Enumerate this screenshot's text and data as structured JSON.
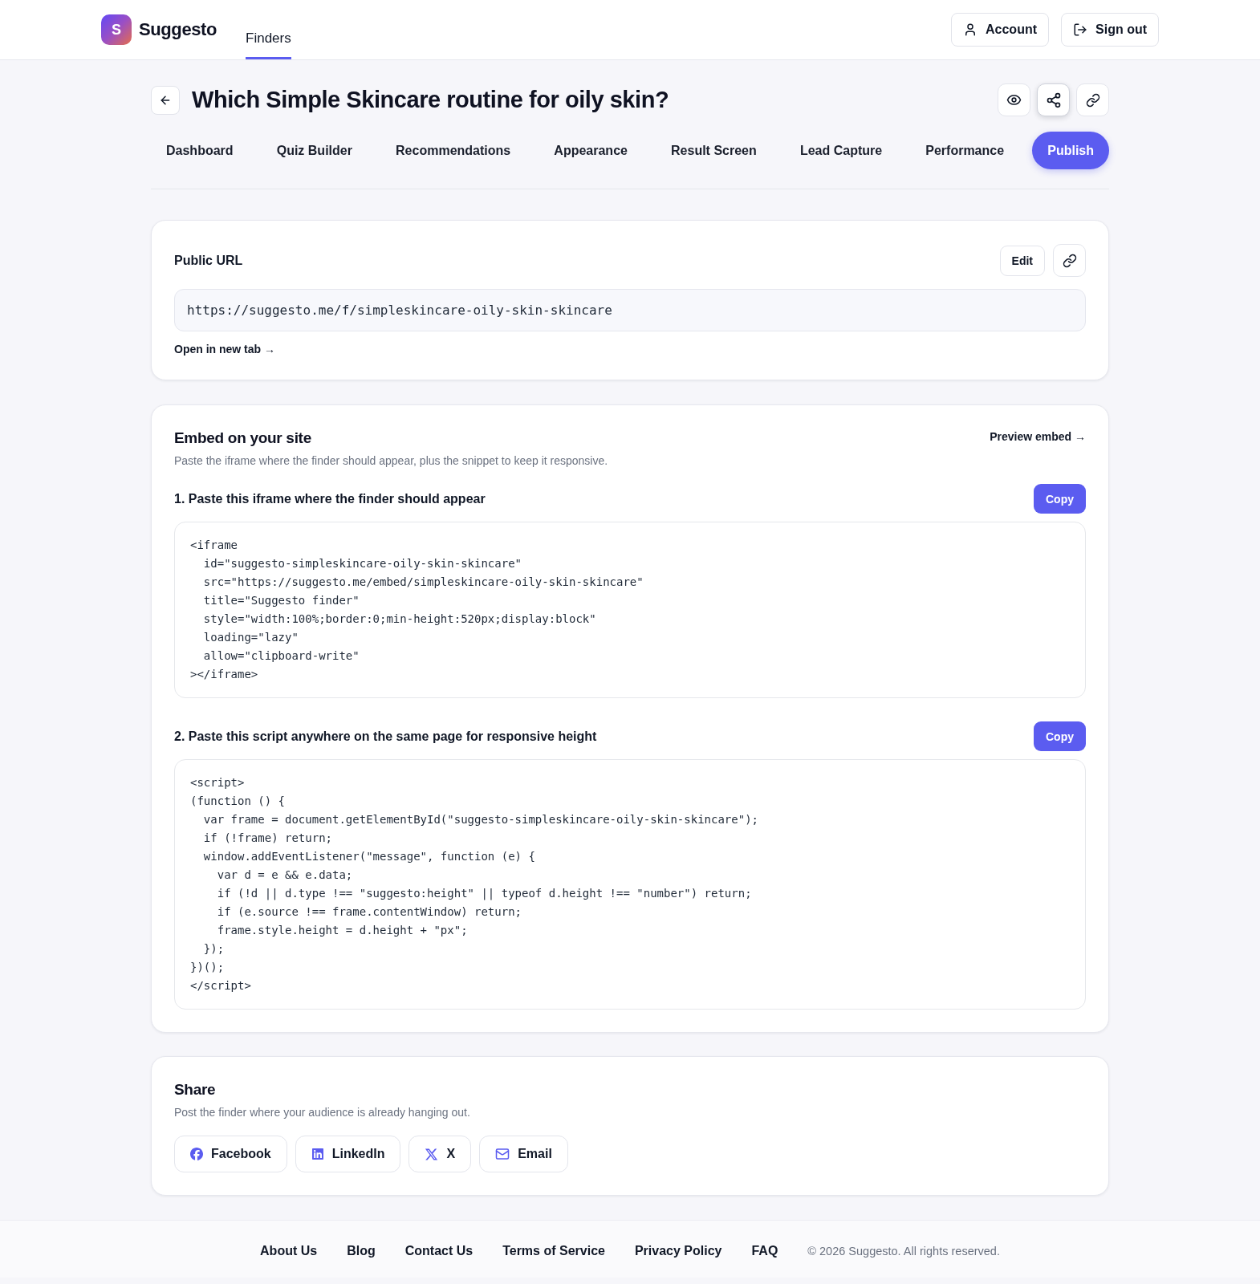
{
  "header": {
    "logo_letter": "S",
    "brand": "Suggesto",
    "nav": [
      {
        "label": "Finders",
        "selected": true
      }
    ],
    "actions": [
      {
        "kind": "account",
        "label": "Account"
      },
      {
        "kind": "sign_out",
        "label": "Sign out"
      }
    ]
  },
  "page": {
    "title": "Which Simple Skincare routine for oily skin?",
    "title_actions": [
      {
        "kind": "preview",
        "selected": false
      },
      {
        "kind": "share",
        "selected": true
      },
      {
        "kind": "link",
        "selected": false
      }
    ]
  },
  "tabs": [
    {
      "label": "Dashboard",
      "selected": false
    },
    {
      "label": "Quiz Builder",
      "selected": false
    },
    {
      "label": "Recommendations",
      "selected": false
    },
    {
      "label": "Appearance",
      "selected": false
    },
    {
      "label": "Result Screen",
      "selected": false
    },
    {
      "label": "Lead Capture",
      "selected": false
    },
    {
      "label": "Performance",
      "selected": false
    },
    {
      "label": "Publish",
      "selected": true
    }
  ],
  "public_url": {
    "title": "Public URL",
    "edit_button": "Edit",
    "url": "https://suggesto.me/f/simpleskincare-oily-skin-skincare",
    "open_link": "Open in new tab →"
  },
  "embed": {
    "title": "Embed on your site",
    "preview_link": "Preview embed →",
    "description": "Paste the iframe where the finder should appear, plus the snippet to keep it responsive.",
    "steps": [
      {
        "label": "1. Paste this iframe where the finder should appear",
        "copy_button": "Copy",
        "code": "<iframe\n  id=\"suggesto-simpleskincare-oily-skin-skincare\"\n  src=\"https://suggesto.me/embed/simpleskincare-oily-skin-skincare\"\n  title=\"Suggesto finder\"\n  style=\"width:100%;border:0;min-height:520px;display:block\"\n  loading=\"lazy\"\n  allow=\"clipboard-write\"\n></iframe>"
      },
      {
        "label": "2. Paste this script anywhere on the same page for responsive height",
        "copy_button": "Copy",
        "code": "<script>\n(function () {\n  var frame = document.getElementById(\"suggesto-simpleskincare-oily-skin-skincare\");\n  if (!frame) return;\n  window.addEventListener(\"message\", function (e) {\n    var d = e && e.data;\n    if (!d || d.type !== \"suggesto:height\" || typeof d.height !== \"number\") return;\n    if (e.source !== frame.contentWindow) return;\n    frame.style.height = d.height + \"px\";\n  });\n})();\n</script>"
      }
    ]
  },
  "share": {
    "title": "Share",
    "description": "Post the finder where your audience is already hanging out.",
    "buttons": [
      {
        "kind": "facebook",
        "label": "Facebook"
      },
      {
        "kind": "linkedin",
        "label": "LinkedIn"
      },
      {
        "kind": "x",
        "label": "X"
      },
      {
        "kind": "email",
        "label": "Email"
      }
    ]
  },
  "footer": {
    "links": [
      "About Us",
      "Blog",
      "Contact Us",
      "Terms of Service",
      "Privacy Policy",
      "FAQ"
    ],
    "copyright": "© 2026 Suggesto. All rights reserved."
  }
}
